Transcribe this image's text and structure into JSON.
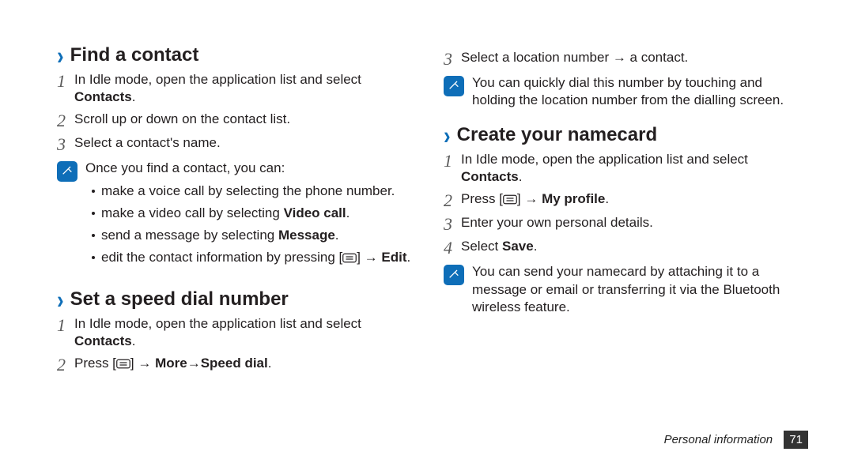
{
  "left": {
    "findContact": {
      "title": "Find a contact",
      "step1_pre": "In Idle mode, open the application list and select ",
      "step1_bold": "Contacts",
      "step1_post": ".",
      "step2": "Scroll up or down on the contact list.",
      "step3": "Select a contact's name.",
      "note_intro": "Once you find a contact, you can:",
      "bullet1": "make a voice call by selecting the phone number.",
      "bullet2_pre": "make a video call by selecting ",
      "bullet2_bold": "Video call",
      "bullet2_post": ".",
      "bullet3_pre": "send a message by selecting ",
      "bullet3_bold": "Message",
      "bullet3_post": ".",
      "bullet4_pre": "edit the contact information by pressing [",
      "bullet4_mid": "] → ",
      "bullet4_bold": "Edit",
      "bullet4_post": "."
    },
    "speedDial": {
      "title": "Set a speed dial number",
      "step1_pre": "In Idle mode, open the application list and select ",
      "step1_bold": "Contacts",
      "step1_post": ".",
      "step2_pre": "Press [",
      "step2_mid": "] → ",
      "step2_bold1": "More",
      "step2_arrow": " → ",
      "step2_bold2": "Speed dial",
      "step2_post": "."
    }
  },
  "right": {
    "step3": "Select a location number → a contact.",
    "note1": "You can quickly dial this number by touching and holding the location number from the dialling screen.",
    "namecard": {
      "title": "Create your namecard",
      "step1_pre": "In Idle mode, open the application list and select ",
      "step1_bold": "Contacts",
      "step1_post": ".",
      "step2_pre": "Press [",
      "step2_mid": "] → ",
      "step2_bold": "My profile",
      "step2_post": ".",
      "step3": "Enter your own personal details.",
      "step4_pre": "Select ",
      "step4_bold": "Save",
      "step4_post": ".",
      "note": "You can send your namecard by attaching it to a message or email or transferring it via the Bluetooth wireless feature."
    }
  },
  "numbers": {
    "n1": "1",
    "n2": "2",
    "n3": "3",
    "n4": "4"
  },
  "footer": {
    "label": "Personal information",
    "page": "71"
  }
}
